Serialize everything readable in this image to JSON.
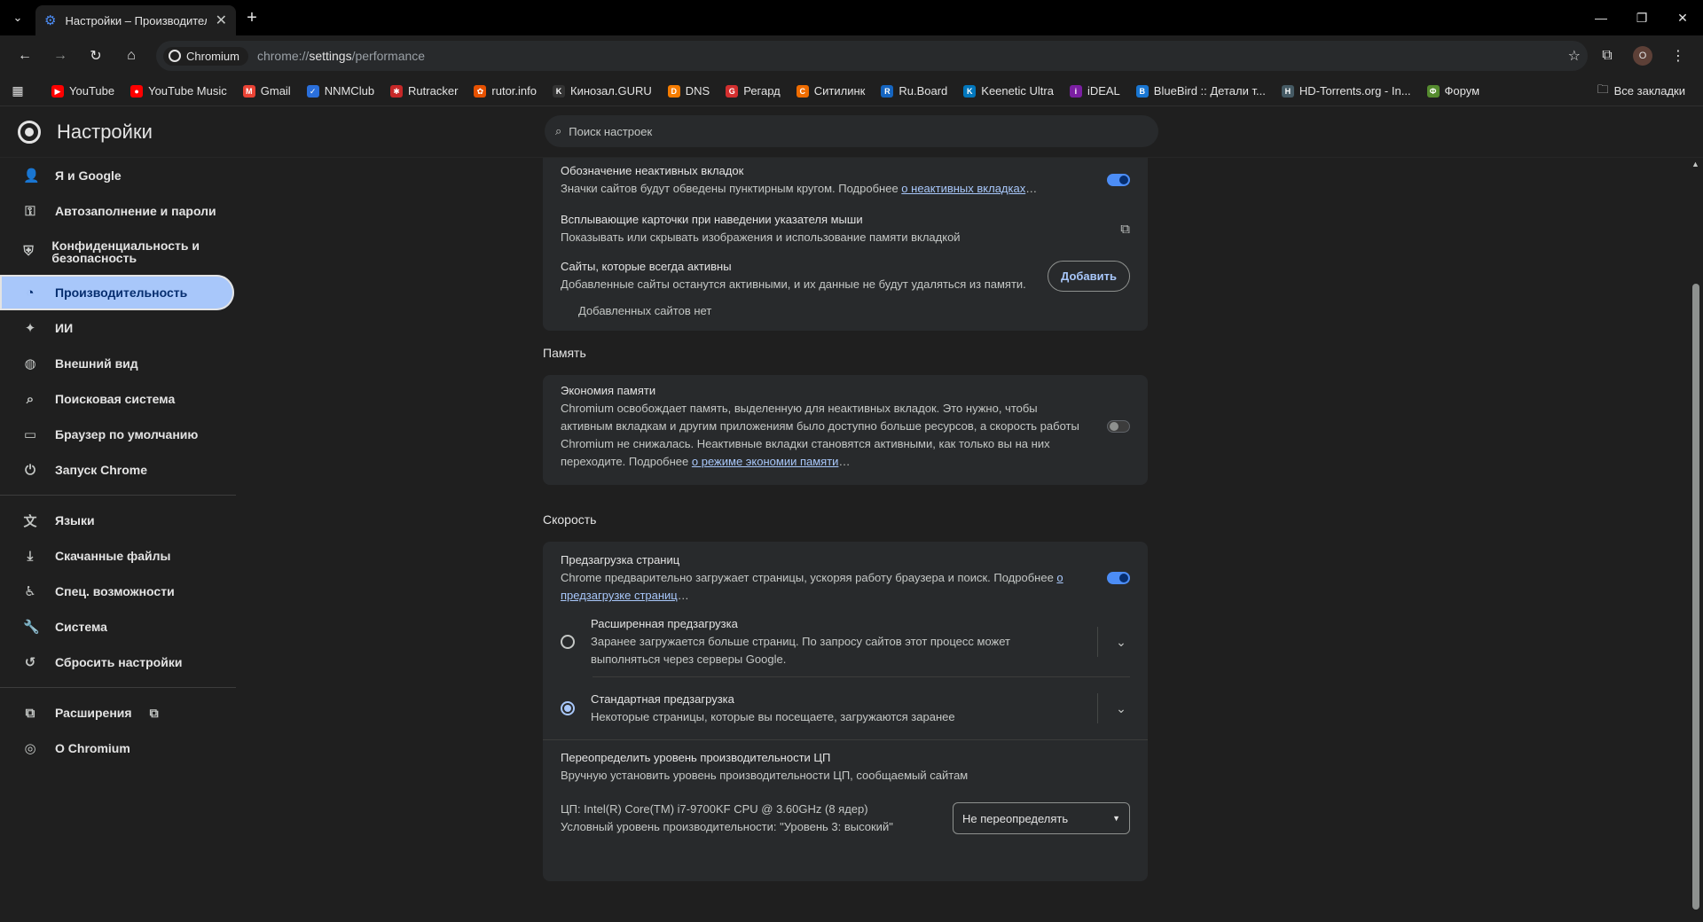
{
  "window": {
    "tab_title": "Настройки – Производительность",
    "tab_close": "✕",
    "new_tab": "+",
    "menu_icon": "⌄"
  },
  "toolbar": {
    "site_chip": "Chromium",
    "url_scheme": "chrome://",
    "url_host": "settings",
    "url_path": "/performance",
    "avatar_letter": "O"
  },
  "bookmarks": {
    "items": [
      {
        "label": "YouTube",
        "color": "#ff0000",
        "glyph": "▶"
      },
      {
        "label": "YouTube Music",
        "color": "#ff0000",
        "glyph": "●"
      },
      {
        "label": "Gmail",
        "color": "#ea4335",
        "glyph": "M"
      },
      {
        "label": "NNMClub",
        "color": "#2a6fdb",
        "glyph": "✓"
      },
      {
        "label": "Rutracker",
        "color": "#c62828",
        "glyph": "✱"
      },
      {
        "label": "rutor.info",
        "color": "#e65100",
        "glyph": "✿"
      },
      {
        "label": "Кинозал.GURU",
        "color": "#333333",
        "glyph": "K"
      },
      {
        "label": "DNS",
        "color": "#f57c00",
        "glyph": "D"
      },
      {
        "label": "Регард",
        "color": "#d32f2f",
        "glyph": "G"
      },
      {
        "label": "Ситилинк",
        "color": "#ef6c00",
        "glyph": "C"
      },
      {
        "label": "Ru.Board",
        "color": "#1565c0",
        "glyph": "R"
      },
      {
        "label": "Keenetic Ultra",
        "color": "#0277bd",
        "glyph": "K"
      },
      {
        "label": "iDEAL",
        "color": "#7b1fa2",
        "glyph": "i"
      },
      {
        "label": "BlueBird :: Детали т...",
        "color": "#1976d2",
        "glyph": "B"
      },
      {
        "label": "HD-Torrents.org - In...",
        "color": "#455a64",
        "glyph": "H"
      },
      {
        "label": "Форум",
        "color": "#558b2f",
        "glyph": "Ф"
      }
    ],
    "all_bookmarks": "Все закладки"
  },
  "settings": {
    "title": "Настройки",
    "search_placeholder": "Поиск настроек",
    "nav": [
      {
        "label": "Я и Google",
        "icon": "person-icon",
        "glyph": "👤"
      },
      {
        "label": "Автозаполнение и пароли",
        "icon": "key-icon",
        "glyph": "⚿"
      },
      {
        "label": "Конфиденциальность и безопасность",
        "icon": "shield-icon",
        "glyph": "⛨"
      },
      {
        "label": "Производительность",
        "icon": "speedometer-icon",
        "glyph": "◔"
      },
      {
        "label": "ИИ",
        "icon": "sparkle-icon",
        "glyph": "✦"
      },
      {
        "label": "Внешний вид",
        "icon": "palette-icon",
        "glyph": "◍"
      },
      {
        "label": "Поисковая система",
        "icon": "search-icon",
        "glyph": "⌕"
      },
      {
        "label": "Браузер по умолчанию",
        "icon": "browser-icon",
        "glyph": "▭"
      },
      {
        "label": "Запуск Chrome",
        "icon": "power-icon",
        "glyph": "⏻"
      },
      {
        "label": "Языки",
        "icon": "translate-icon",
        "glyph": "文"
      },
      {
        "label": "Скачанные файлы",
        "icon": "download-icon",
        "glyph": "⤓"
      },
      {
        "label": "Спец. возможности",
        "icon": "accessibility-icon",
        "glyph": "♿"
      },
      {
        "label": "Система",
        "icon": "wrench-icon",
        "glyph": "🔧"
      },
      {
        "label": "Сбросить настройки",
        "icon": "reset-icon",
        "glyph": "↺"
      },
      {
        "label": "Расширения",
        "icon": "puzzle-icon",
        "glyph": "⧉"
      },
      {
        "label": "О Chromium",
        "icon": "chromium-icon",
        "glyph": "◎"
      }
    ]
  },
  "tabs_card": {
    "inactive_title": "Обозначение неактивных вкладок",
    "inactive_desc": "Значки сайтов будут обведены пунктирным кругом. Подробнее ",
    "inactive_link": "о неактивных вкладках",
    "inactive_ellipsis": "…",
    "hover_title": "Всплывающие карточки при наведении указателя мыши",
    "hover_desc": "Показывать или скрывать изображения и использование памяти вкладкой",
    "always_title": "Сайты, которые всегда активны",
    "always_desc": "Добавленные сайты останутся активными, и их данные не будут удаляться из памяти.",
    "add_button": "Добавить",
    "no_sites": "Добавленных сайтов нет"
  },
  "memory": {
    "section": "Память",
    "title": "Экономия памяти",
    "desc": "Chromium освобождает память, выделенную для неактивных вкладок. Это нужно, чтобы активным вкладкам и другим приложениям было доступно больше ресурсов, а скорость работы Chromium не снижалась. Неактивные вкладки становятся активными, как только вы на них переходите. Подробнее ",
    "link": "о режиме экономии памяти",
    "ellipsis": "…"
  },
  "speed": {
    "section": "Скорость",
    "preload_title": "Предзагрузка страниц",
    "preload_desc": "Chrome предварительно загружает страницы, ускоряя работу браузера и поиск. Подробнее ",
    "preload_link": "о предзагрузке страниц",
    "preload_ellipsis": "…",
    "extended_title": "Расширенная предзагрузка",
    "extended_desc": "Заранее загружается больше страниц. По запросу сайтов этот процесс может выполняться через серверы Google.",
    "standard_title": "Стандартная предзагрузка",
    "standard_desc": "Некоторые страницы, которые вы посещаете, загружаются заранее",
    "cpu_title": "Переопределить уровень производительности ЦП",
    "cpu_desc": "Вручную установить уровень производительности ЦП, сообщаемый сайтам",
    "cpu_info": "ЦП: Intel(R) Core(TM) i7-9700KF CPU @ 3.60GHz (8 ядер)",
    "cpu_level": "Условный уровень производительности: \"Уровень 3: высокий\"",
    "cpu_select": "Не переопределять"
  }
}
